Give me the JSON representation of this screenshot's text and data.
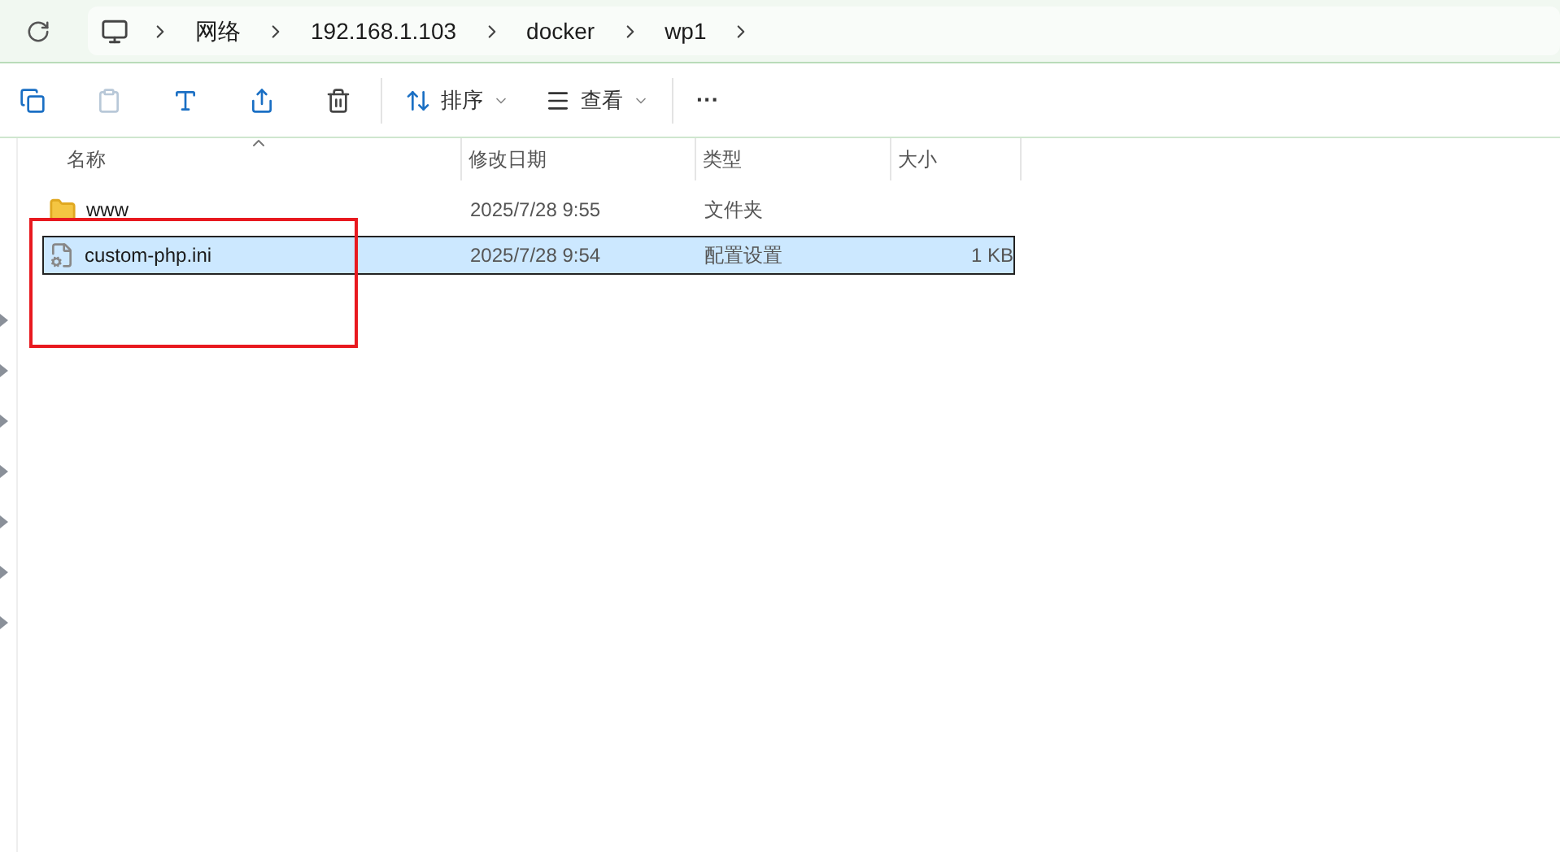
{
  "breadcrumb": [
    "网络",
    "192.168.1.103",
    "docker",
    "wp1"
  ],
  "toolbar": {
    "sort": "排序",
    "view": "查看",
    "more": "···"
  },
  "columns": [
    "名称",
    "修改日期",
    "类型",
    "大小"
  ],
  "rows": [
    {
      "kind": "folder",
      "name": "www",
      "date": "2025/7/28 9:55",
      "type": "文件夹",
      "selected": false
    },
    {
      "kind": "file",
      "name": "custom-php.ini",
      "date": "2025/7/28 9:54",
      "type": "配置设置",
      "size": "1 KB",
      "selected": true
    }
  ]
}
